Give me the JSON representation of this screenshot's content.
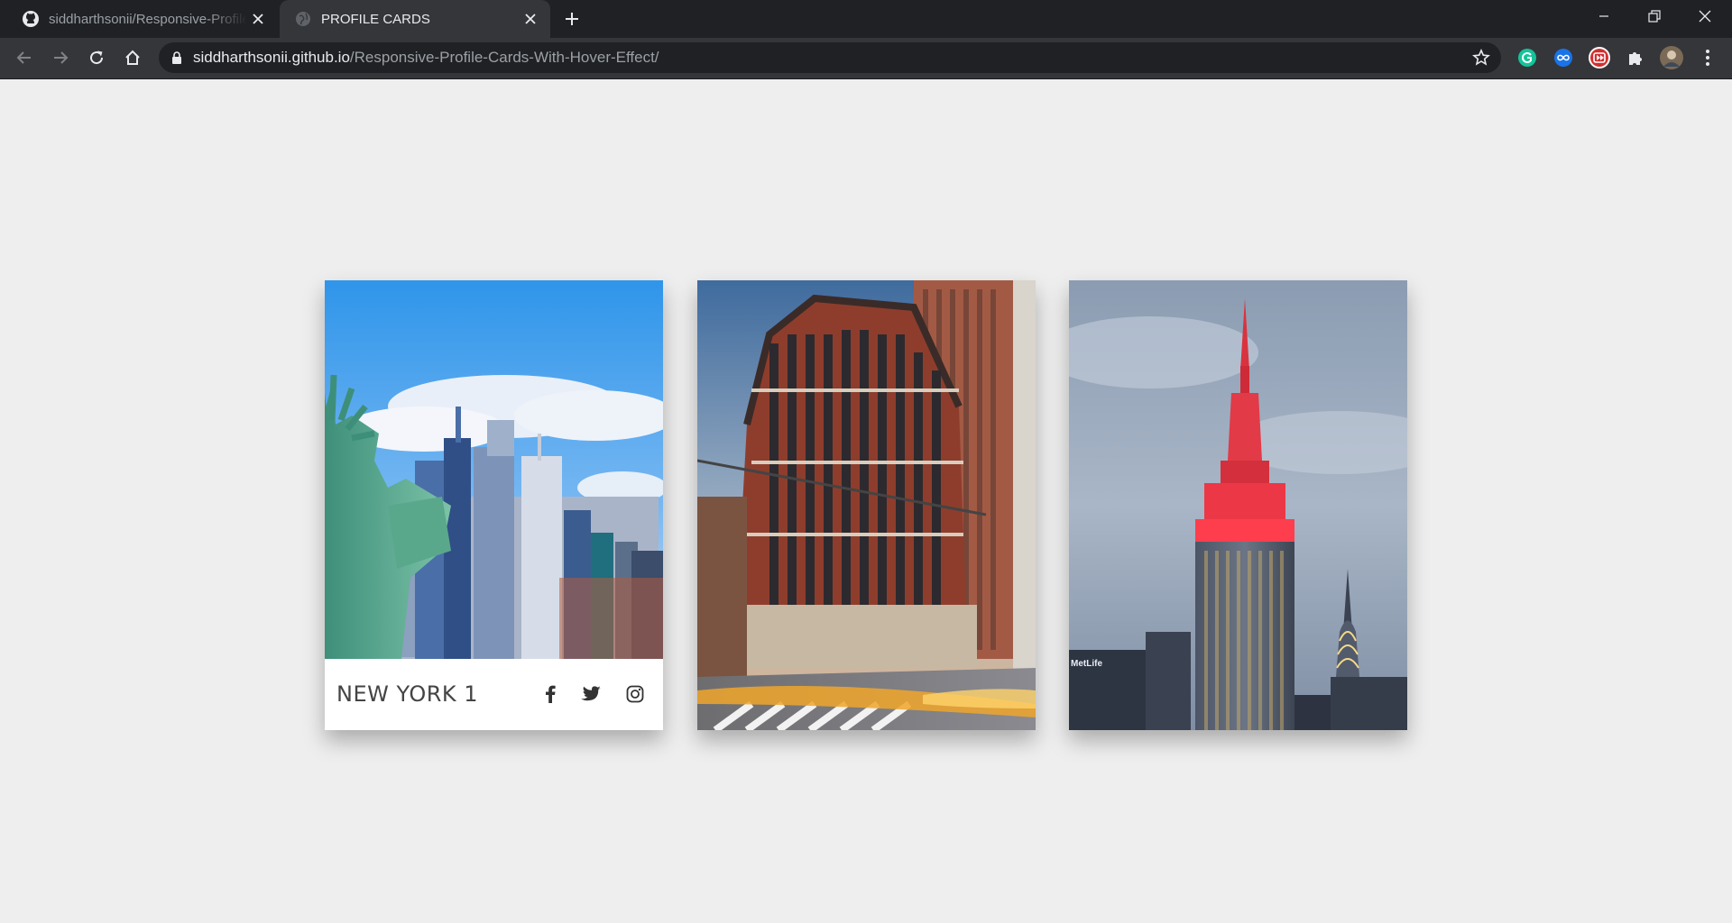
{
  "browser": {
    "tabs": [
      {
        "title": "siddharthsonii/Responsive-Profile-Cards-With-Hover-Effect",
        "favicon": "github-icon",
        "active": false
      },
      {
        "title": "PROFILE CARDS",
        "favicon": "globe-icon",
        "active": true
      }
    ],
    "url_host": "siddharthsonii.github.io",
    "url_path": "/Responsive-Profile-Cards-With-Hover-Effect/",
    "extensions": [
      "grammarly-icon",
      "infinity-extension-icon",
      "video-speed-icon",
      "puzzle-icon",
      "profile-avatar"
    ]
  },
  "cards": [
    {
      "title": "NEW YORK 1",
      "image": "statue-of-liberty-and-manhattan-skyline",
      "social": [
        "facebook-icon",
        "twitter-icon",
        "instagram-icon"
      ]
    },
    {
      "image": "red-brick-corner-hotel-building-street"
    },
    {
      "image": "empire-state-building-red-lights"
    }
  ],
  "colors": {
    "page_bg": "#eeeeee",
    "chrome_dark": "#202124",
    "chrome_toolbar": "#35363a",
    "card_title": "#444444"
  }
}
